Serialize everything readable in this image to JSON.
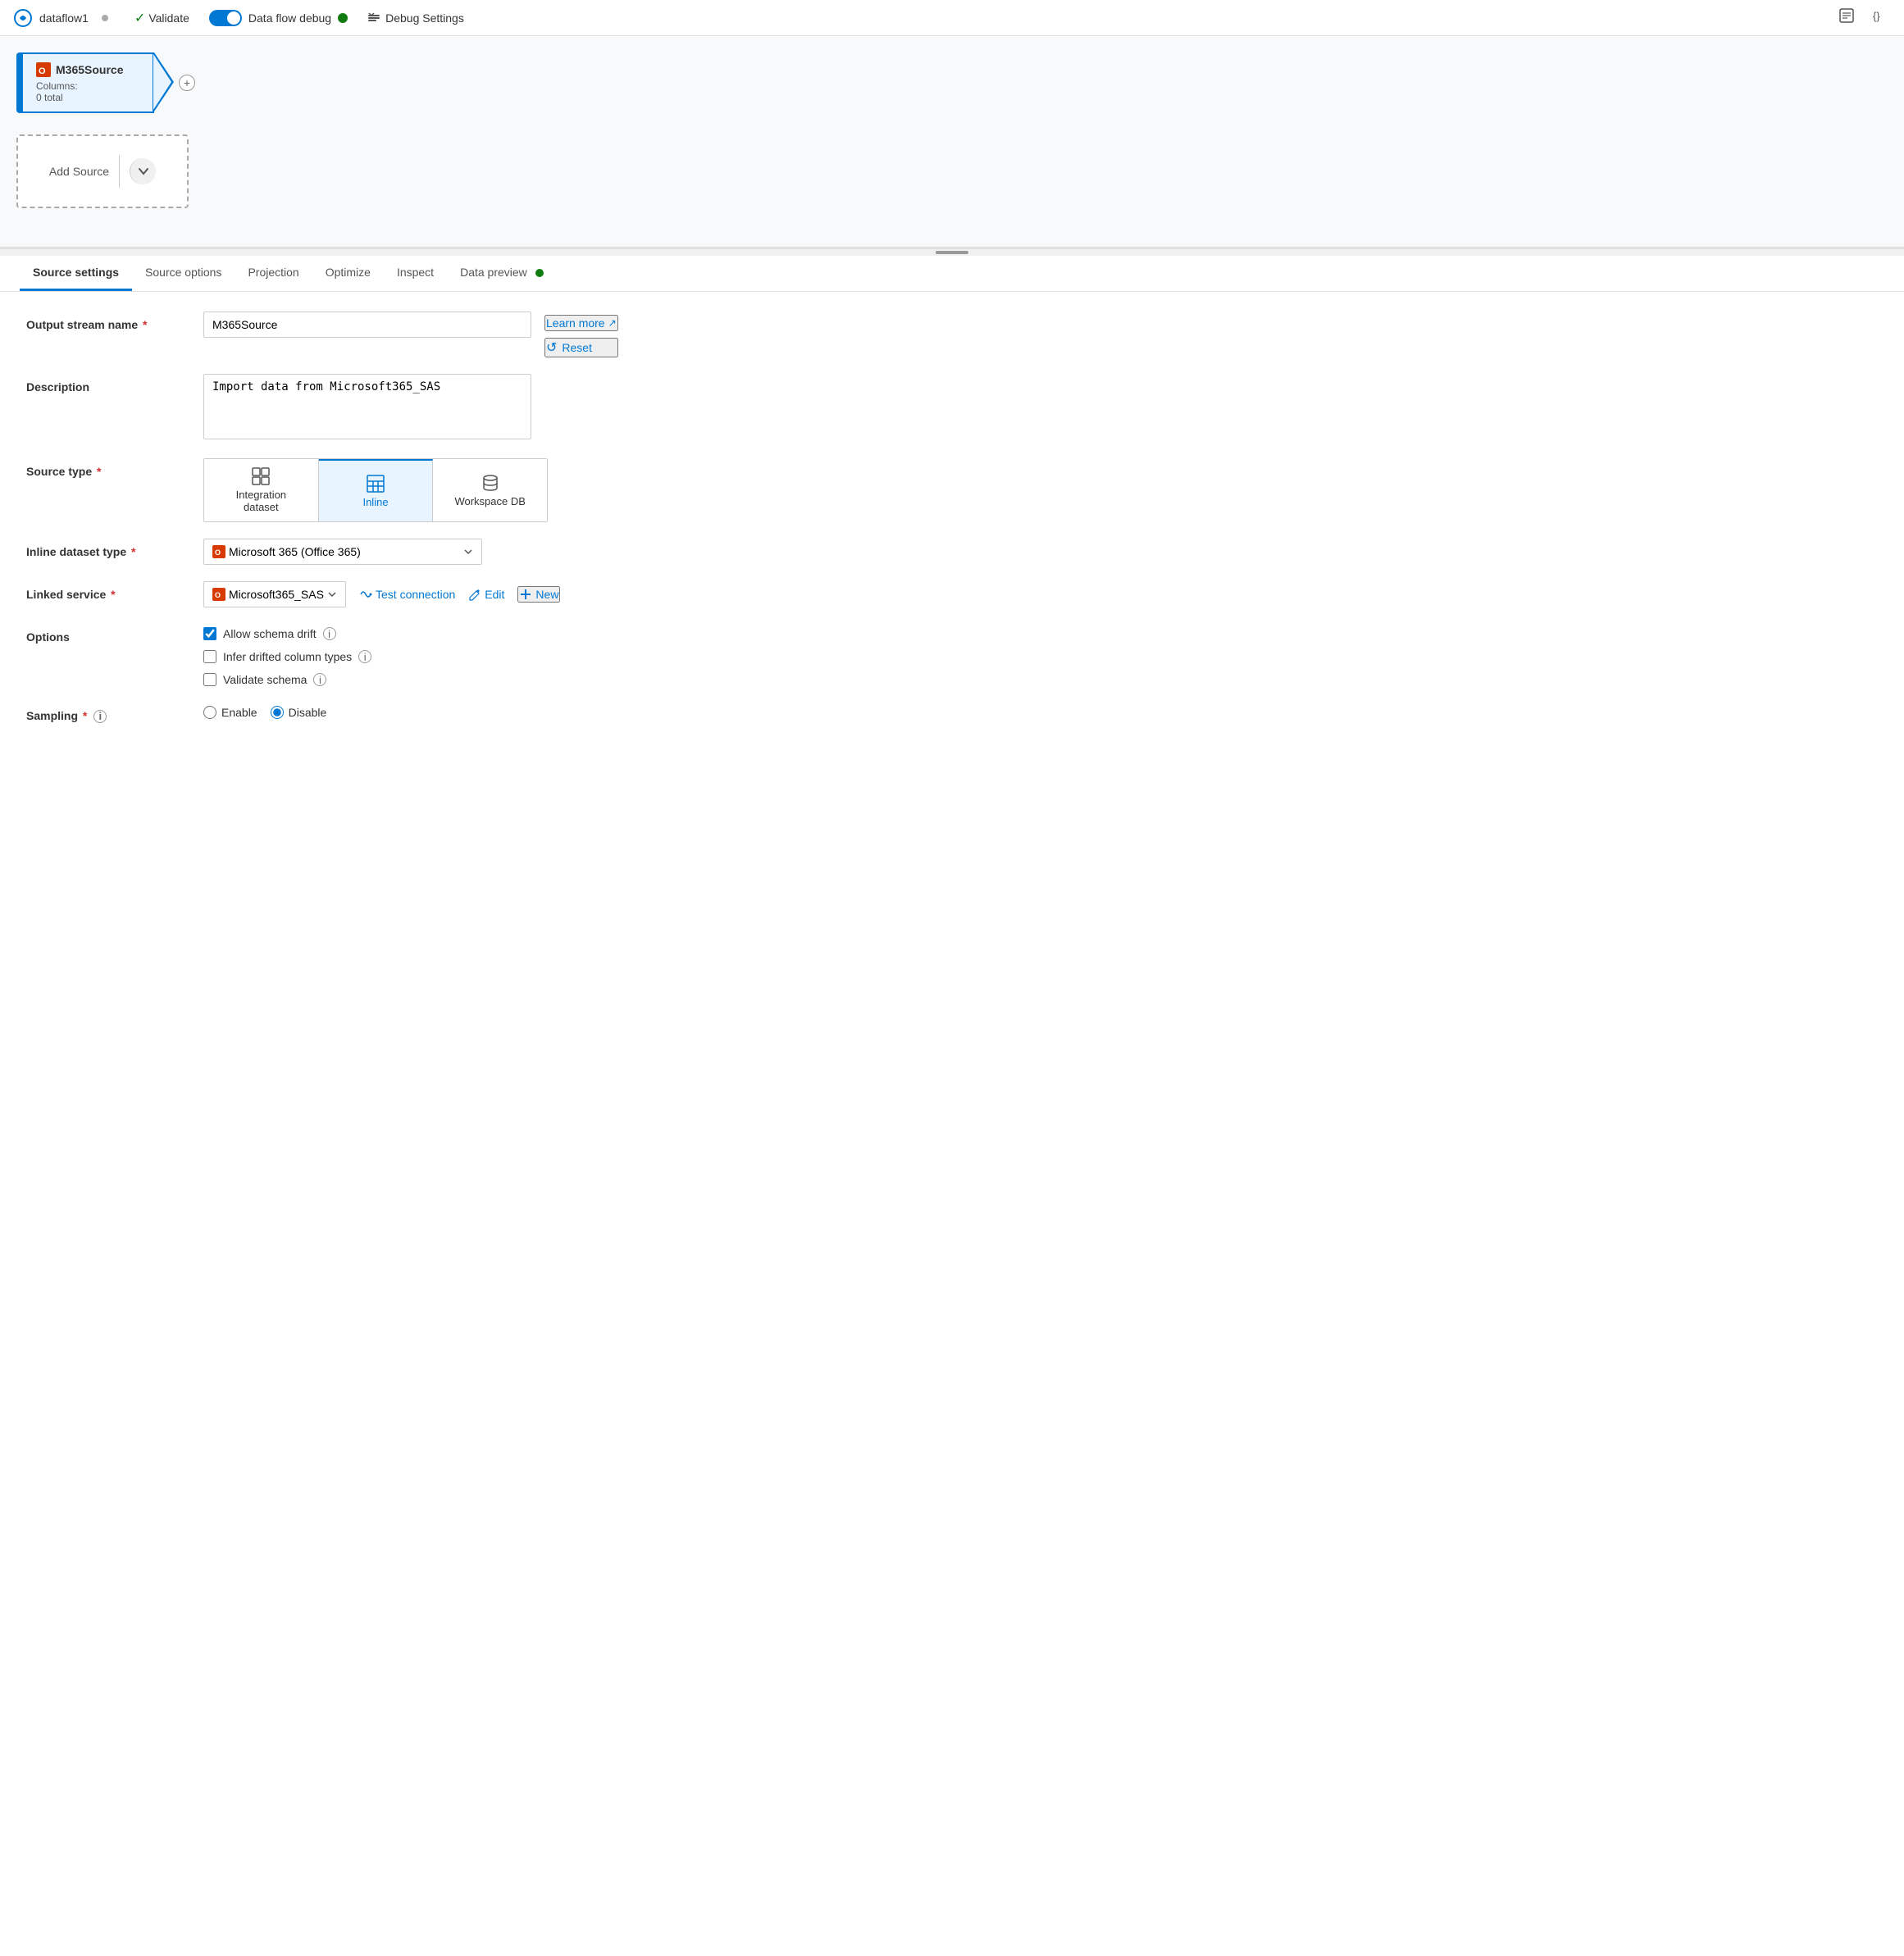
{
  "app": {
    "title": "dataflow1",
    "unsaved": true
  },
  "toolbar": {
    "validate_label": "Validate",
    "debug_label": "Data flow debug",
    "debug_settings_label": "Debug Settings",
    "debug_active": true,
    "debug_status": "active"
  },
  "canvas": {
    "node": {
      "title": "M365Source",
      "meta_label": "Columns:",
      "meta_value": "0 total",
      "plus": "+"
    },
    "add_source": {
      "label": "Add Source",
      "chevron": "∨"
    }
  },
  "tabs": [
    {
      "id": "source-settings",
      "label": "Source settings",
      "active": true
    },
    {
      "id": "source-options",
      "label": "Source options",
      "active": false
    },
    {
      "id": "projection",
      "label": "Projection",
      "active": false
    },
    {
      "id": "optimize",
      "label": "Optimize",
      "active": false
    },
    {
      "id": "inspect",
      "label": "Inspect",
      "active": false
    },
    {
      "id": "data-preview",
      "label": "Data preview",
      "has_dot": true,
      "active": false
    }
  ],
  "form": {
    "output_stream_name": {
      "label": "Output stream name",
      "required": true,
      "value": "M365Source",
      "placeholder": ""
    },
    "description": {
      "label": "Description",
      "required": false,
      "value": "Import data from Microsoft365_SAS",
      "placeholder": ""
    },
    "learn_more": {
      "label": "Learn more",
      "icon": "↗"
    },
    "reset": {
      "label": "Reset",
      "icon": "↺"
    },
    "source_type": {
      "label": "Source type",
      "required": true,
      "options": [
        {
          "id": "integration-dataset",
          "label": "Integration dataset",
          "icon": "⊞",
          "active": false
        },
        {
          "id": "inline",
          "label": "Inline",
          "icon": "⊟",
          "active": true
        },
        {
          "id": "workspace-db",
          "label": "Workspace DB",
          "icon": "🗄",
          "active": false
        }
      ]
    },
    "inline_dataset_type": {
      "label": "Inline dataset type",
      "required": true,
      "value": "Microsoft 365 (Office 365)",
      "options": [
        "Microsoft 365 (Office 365)"
      ]
    },
    "linked_service": {
      "label": "Linked service",
      "required": true,
      "value": "Microsoft365_SAS",
      "options": [
        "Microsoft365_SAS"
      ],
      "test_connection_label": "Test connection",
      "edit_label": "Edit",
      "new_label": "New"
    },
    "options": {
      "label": "Options",
      "items": [
        {
          "id": "allow-schema-drift",
          "label": "Allow schema drift",
          "checked": true,
          "has_info": true
        },
        {
          "id": "infer-drifted-column-types",
          "label": "Infer drifted column types",
          "checked": false,
          "has_info": true
        },
        {
          "id": "validate-schema",
          "label": "Validate schema",
          "checked": false,
          "has_info": true
        }
      ]
    },
    "sampling": {
      "label": "Sampling",
      "required": true,
      "has_info": true,
      "options": [
        {
          "id": "enable",
          "label": "Enable",
          "checked": false
        },
        {
          "id": "disable",
          "label": "Disable",
          "checked": true
        }
      ]
    }
  }
}
